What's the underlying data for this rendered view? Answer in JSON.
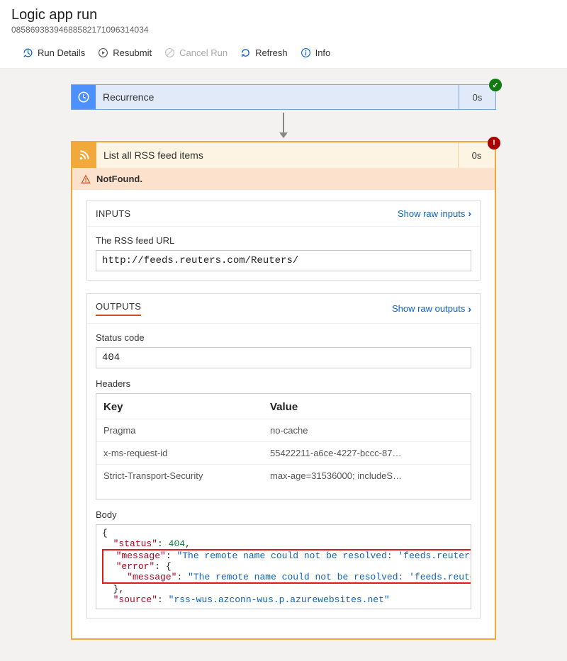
{
  "header": {
    "title": "Logic app run",
    "run_id": "08586938394688582171096314034"
  },
  "toolbar": {
    "run_details": "Run Details",
    "resubmit": "Resubmit",
    "cancel": "Cancel Run",
    "refresh": "Refresh",
    "info": "Info"
  },
  "trigger": {
    "name": "Recurrence",
    "duration": "0s",
    "status": "success"
  },
  "action": {
    "name": "List all RSS feed items",
    "duration": "0s",
    "status": "error",
    "error_label": "NotFound."
  },
  "inputs": {
    "heading": "INPUTS",
    "show_raw": "Show raw inputs",
    "field_label": "The RSS feed URL",
    "field_value": "http://feeds.reuters.com/Reuters/"
  },
  "outputs": {
    "heading": "OUTPUTS",
    "show_raw": "Show raw outputs",
    "status_label": "Status code",
    "status_value": "404",
    "headers_label": "Headers",
    "headers_key_col": "Key",
    "headers_val_col": "Value",
    "headers": [
      {
        "key": "Pragma",
        "value": "no-cache"
      },
      {
        "key": "x-ms-request-id",
        "value": "55422211-a6ce-4227-bccc-87…"
      },
      {
        "key": "Strict-Transport-Security",
        "value": "max-age=31536000; includeS…"
      }
    ],
    "body_label": "Body",
    "body": {
      "status_key": "\"status\"",
      "status_val": "404",
      "message_key": "\"message\"",
      "message_val": "\"The remote name could not be resolved: 'feeds.reuters",
      "error_key": "\"error\"",
      "inner_message_key": "\"message\"",
      "inner_message_val": "\"The remote name could not be resolved: 'feeds.reute",
      "source_key": "\"source\"",
      "source_val": "\"rss-wus.azconn-wus.p.azurewebsites.net\""
    }
  }
}
